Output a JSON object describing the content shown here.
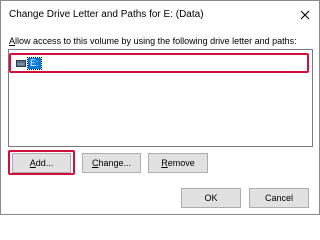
{
  "window": {
    "title": "Change Drive Letter and Paths for E: (Data)",
    "close_icon": "close-icon"
  },
  "instruction": {
    "lead": "A",
    "rest": "llow access to this volume by using the following drive letter and paths:"
  },
  "list": {
    "items": [
      {
        "label": "E:",
        "icon": "drive-icon",
        "selected": true
      }
    ]
  },
  "buttons": {
    "add": {
      "mnemonic": "A",
      "rest": "dd..."
    },
    "change": {
      "mnemonic": "C",
      "rest": "hange..."
    },
    "remove": {
      "mnemonic": "R",
      "rest": "emove"
    },
    "ok": "OK",
    "cancel": "Cancel"
  },
  "colors": {
    "highlight_border": "#d0103a",
    "selection": "#0078d7"
  }
}
